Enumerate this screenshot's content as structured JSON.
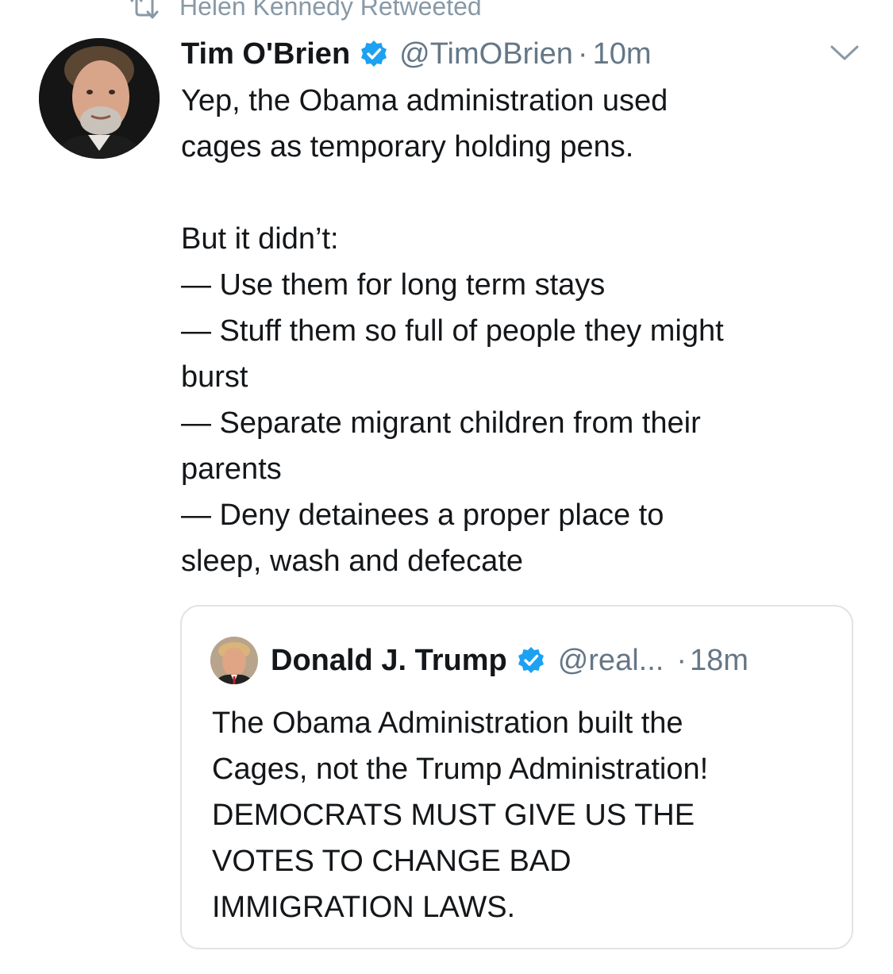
{
  "retweet": {
    "icon": "retweet-icon",
    "label": "Helen Kennedy Retweeted"
  },
  "tweet": {
    "author_name": "Tim O'Brien",
    "verified_icon": "verified-badge-icon",
    "handle": "@TimOBrien",
    "separator": "·",
    "time": "10m",
    "menu_icon": "chevron-down-icon",
    "lines": [
      "Yep, the Obama administration used",
      "cages as temporary holding pens.",
      "",
      "But it didn’t:",
      "— Use them for long term stays",
      "— Stuff them so full of people they might",
      "burst",
      "— Separate migrant children from their",
      "parents",
      "— Deny detainees a proper place to",
      "sleep, wash and defecate"
    ]
  },
  "quoted_tweet": {
    "author_name": "Donald J. Trump",
    "verified_icon": "verified-badge-icon",
    "handle": "@real...",
    "separator": "·",
    "time": "18m",
    "lines": [
      "The Obama Administration built the",
      "Cages, not the Trump Administration!",
      "DEMOCRATS MUST GIVE US THE",
      "VOTES TO CHANGE BAD",
      "IMMIGRATION LAWS."
    ]
  },
  "colors": {
    "text_primary": "#14171a",
    "text_secondary": "#657786",
    "retweet_gray": "#8899a6",
    "verified_blue": "#1da1f2",
    "card_border": "#dfe4e8"
  }
}
